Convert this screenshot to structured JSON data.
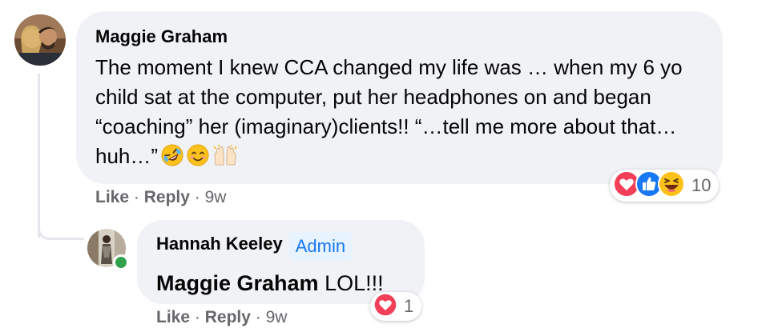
{
  "comment": {
    "author": "Maggie Graham",
    "text": "The moment I knew CCA changed my life was … when my 6 yo child sat at the computer, put her headphones on and began “coaching” her (imaginary)clients!! “…tell me more about that…huh…”",
    "emojis": [
      "rolling-on-floor-laughing",
      "smiling-face",
      "raising-hands"
    ],
    "actions": {
      "like": "Like",
      "reply": "Reply",
      "sep": "·",
      "time": "9w"
    },
    "reactions": {
      "types": [
        "love",
        "like",
        "haha"
      ],
      "count": "10"
    }
  },
  "reply": {
    "author": "Hannah Keeley",
    "badge": "Admin",
    "mention": "Maggie Graham",
    "text": "LOL!!!",
    "actions": {
      "like": "Like",
      "reply": "Reply",
      "sep": "·",
      "time": "9w"
    },
    "reactions": {
      "types": [
        "love"
      ],
      "count": "1"
    },
    "online": true
  },
  "colors": {
    "bubble": "#f0f2f5",
    "meta": "#65676b",
    "admin_bg": "#e7f3ff",
    "admin_text": "#1877f2",
    "online": "#31a24c"
  }
}
